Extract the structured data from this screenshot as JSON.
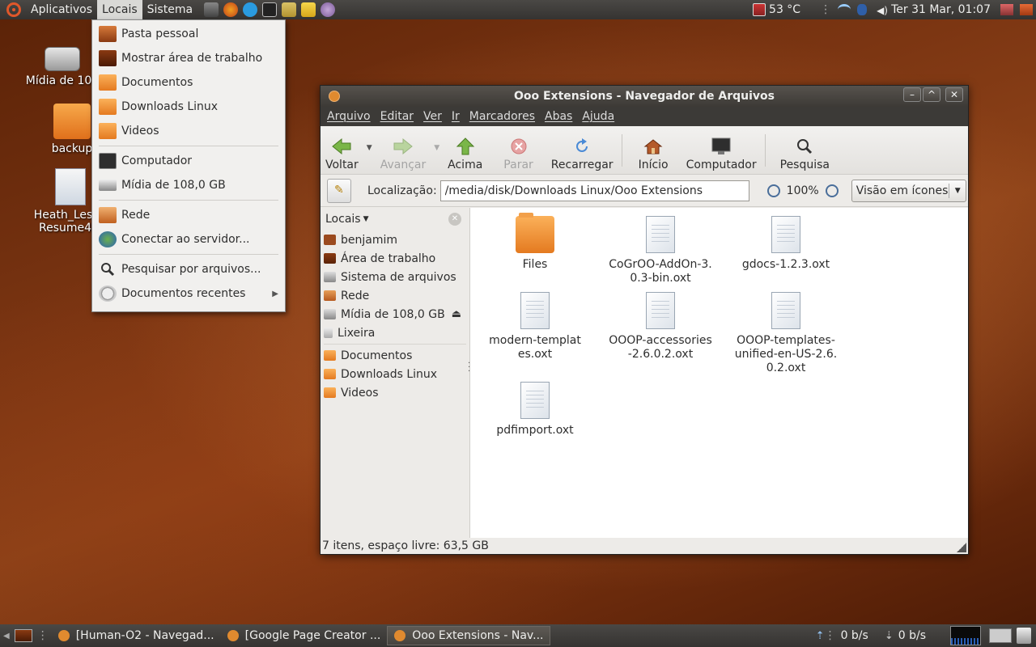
{
  "top_panel": {
    "menus": [
      "Aplicativos",
      "Locais",
      "Sistema"
    ],
    "temperature": "53 °C",
    "clock": "Ter 31 Mar, 01:07"
  },
  "desktop": {
    "icons": [
      {
        "label": "Mídia de 108"
      },
      {
        "label": "backup"
      },
      {
        "label": "Heath_Lesj… Resume4.o"
      }
    ]
  },
  "places_menu": {
    "items": [
      {
        "label": "Pasta pessoal",
        "icon": "home-icon"
      },
      {
        "label": "Mostrar área de trabalho",
        "icon": "desktop-icon"
      },
      {
        "label": "Documentos",
        "icon": "folder-icon"
      },
      {
        "label": "Downloads Linux",
        "icon": "folder-icon"
      },
      {
        "label": "Videos",
        "icon": "folder-icon"
      },
      {
        "label": "Computador",
        "icon": "computer-icon"
      },
      {
        "label": "Mídia de 108,0 GB",
        "icon": "drive-icon"
      },
      {
        "label": "Rede",
        "icon": "network-icon"
      },
      {
        "label": "Conectar ao servidor...",
        "icon": "globe-icon"
      },
      {
        "label": "Pesquisar por arquivos...",
        "icon": "search-icon"
      },
      {
        "label": "Documentos recentes",
        "icon": "recent-icon"
      }
    ]
  },
  "window": {
    "title": "Ooo Extensions - Navegador de Arquivos",
    "menus": [
      "Arquivo",
      "Editar",
      "Ver",
      "Ir",
      "Marcadores",
      "Abas",
      "Ajuda"
    ],
    "toolbar": {
      "back": "Voltar",
      "forward": "Avançar",
      "up": "Acima",
      "stop": "Parar",
      "reload": "Recarregar",
      "home": "Início",
      "computer": "Computador",
      "search": "Pesquisa"
    },
    "location_label": "Localização:",
    "location_value": "/media/disk/Downloads Linux/Ooo Extensions",
    "zoom": "100%",
    "view_mode": "Visão em ícones",
    "sidebar": {
      "header": "Locais",
      "items": [
        {
          "label": "benjamim",
          "icon": "home-icon"
        },
        {
          "label": "Área de trabalho",
          "icon": "desktop-icon"
        },
        {
          "label": "Sistema de arquivos",
          "icon": "drive-icon"
        },
        {
          "label": "Rede",
          "icon": "network-icon"
        },
        {
          "label": "Mídia de 108,0 GB",
          "icon": "drive-icon"
        },
        {
          "label": "Lixeira",
          "icon": "trash-icon"
        },
        {
          "label": "Documentos",
          "icon": "folder-icon"
        },
        {
          "label": "Downloads Linux",
          "icon": "folder-icon"
        },
        {
          "label": "Videos",
          "icon": "folder-icon"
        }
      ]
    },
    "files": [
      {
        "name": "Files",
        "type": "folder"
      },
      {
        "name": "CoGrOO-AddOn-3.0.3-bin.oxt",
        "type": "file"
      },
      {
        "name": "gdocs-1.2.3.oxt",
        "type": "file"
      },
      {
        "name": "modern-templates.oxt",
        "type": "file"
      },
      {
        "name": "OOOP-accessories-2.6.0.2.oxt",
        "type": "file"
      },
      {
        "name": "OOOP-templates-unified-en-US-2.6.0.2.oxt",
        "type": "file"
      },
      {
        "name": "pdfimport.oxt",
        "type": "file"
      }
    ],
    "status": "7 itens, espaço livre: 63,5 GB"
  },
  "bottom_panel": {
    "tasks": [
      {
        "label": "[Human-O2 - Navegad...",
        "active": false
      },
      {
        "label": "[Google Page Creator ...",
        "active": false
      },
      {
        "label": "Ooo Extensions - Nav...",
        "active": true
      }
    ],
    "net_up": "0 b/s",
    "net_down": "0 b/s"
  },
  "colors": {
    "accent_orange": "#e47a20",
    "panel_dark": "#3c3a37",
    "menu_bg": "#f1f0ee"
  }
}
